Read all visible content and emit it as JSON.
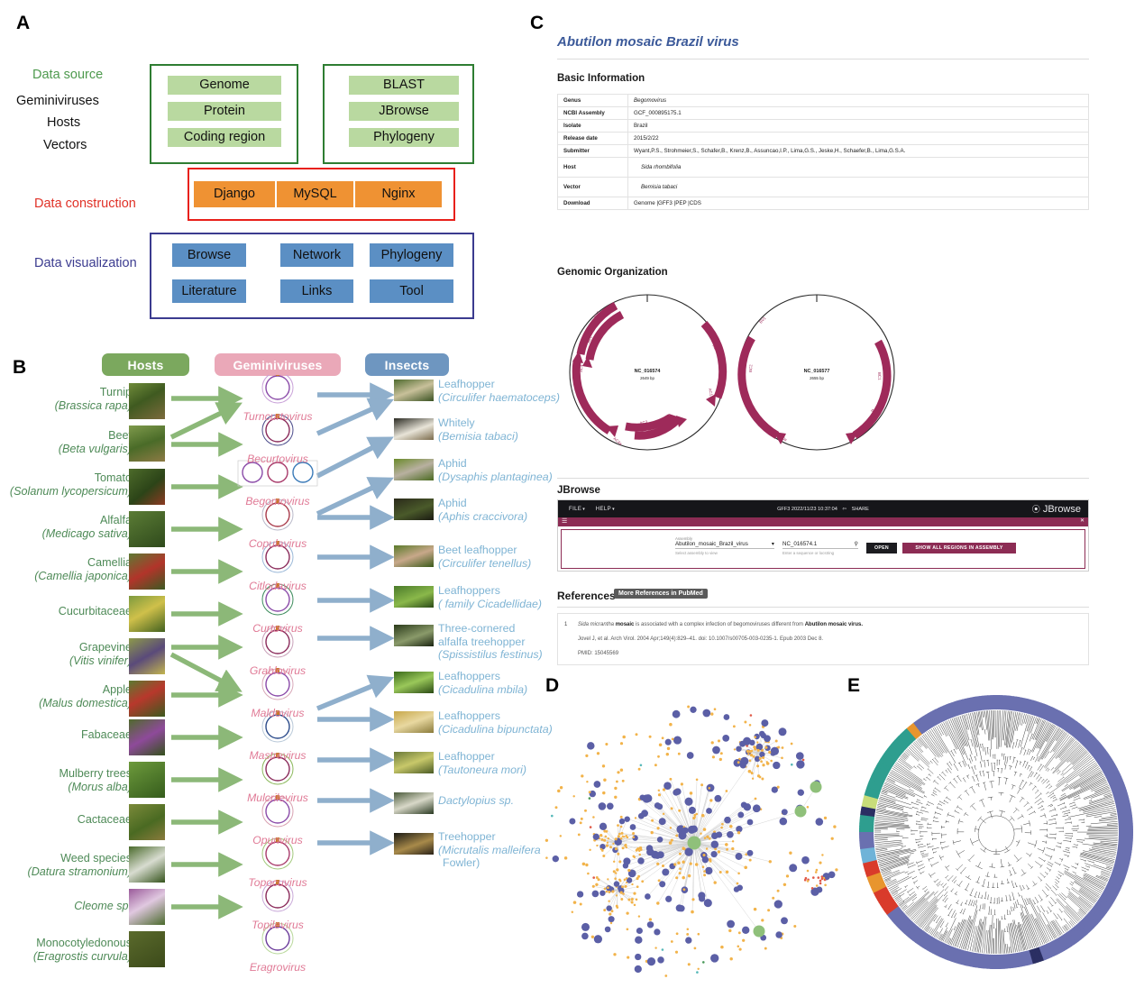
{
  "panels": {
    "a": "A",
    "b": "B",
    "c": "C",
    "d": "D",
    "e": "E"
  },
  "panel_a": {
    "row_labels": [
      {
        "text": "Data source",
        "color": "#4e9a4e"
      },
      {
        "text": "Geminiviruses",
        "color": "#111111"
      },
      {
        "text": "Hosts",
        "color": "#111111"
      },
      {
        "text": "Vectors",
        "color": "#111111"
      },
      {
        "text": "Data construction",
        "color": "#e03127"
      },
      {
        "text": "Data visualization",
        "color": "#3b3b8f"
      }
    ],
    "source_box_left": [
      "Genome",
      "Protein",
      "Coding region"
    ],
    "source_box_right": [
      "BLAST",
      "JBrowse",
      "Phylogeny"
    ],
    "construction": [
      "Django",
      "MySQL",
      "Nginx"
    ],
    "visualization_row1": [
      "Browse",
      "Network",
      "Phylogeny"
    ],
    "visualization_row2": [
      "Literature",
      "Links",
      "Tool"
    ],
    "colors": {
      "green_border": "#2e7d32",
      "green_chip": "#b9d9a0",
      "red_border": "#e8201a",
      "orange_chip": "#ef9233",
      "blue_border": "#3b3b8f",
      "blue_chip": "#5b8fc4"
    }
  },
  "panel_b": {
    "headers": [
      {
        "label": "Hosts",
        "color": "#7ba košice"
      },
      {
        "label": "Geminiviruses",
        "color": "#eaa8b8"
      },
      {
        "label": "Insects",
        "color": "#6e96c0"
      }
    ],
    "header_hosts": "Hosts",
    "header_viruses": "Geminiviruses",
    "header_insects": "Insects",
    "hosts": [
      {
        "common": "Turnip",
        "latin": "(Brassica rapa)"
      },
      {
        "common": "Beet",
        "latin": "(Beta vulgaris)"
      },
      {
        "common": "Tomato",
        "latin": "(Solanum lycopersicum)"
      },
      {
        "common": "Alfalfa",
        "latin": "(Medicago sativa)"
      },
      {
        "common": "Camellia",
        "latin": "(Camellia japonica)"
      },
      {
        "common": "Cucurbitaceae",
        "latin": ""
      },
      {
        "common": "Grapevine",
        "latin": "(Vitis vinifer)"
      },
      {
        "common": "Apple",
        "latin": "(Malus domestica)"
      },
      {
        "common": "Fabaceae",
        "latin": ""
      },
      {
        "common": "Mulberry trees",
        "latin": "(Morus alba)"
      },
      {
        "common": "Cactaceae",
        "latin": ""
      },
      {
        "common": "Weed species",
        "latin": "(Datura stramonium)"
      },
      {
        "common": "Cleome sp.",
        "latin": ""
      },
      {
        "common": "Monocotyledonous",
        "latin": "(Eragrostis curvula)"
      }
    ],
    "viruses": [
      "Turncurtovirus",
      "Becurtovirus",
      "Begomovirus",
      "Copulavirus",
      "Citlodavirus",
      "Curtovirus",
      "Grablovirus",
      "Maldovirus",
      "Mastrevirus",
      "Mulcrilevirus",
      "Opunvirus",
      "Topocuvirus",
      "Topilevirus",
      "Eragrovirus"
    ],
    "insects": [
      {
        "common": "Leafhopper",
        "latin": "(Circulifer haematoceps)"
      },
      {
        "common": "Whitely",
        "latin": "(Bemisia tabaci)"
      },
      {
        "common": "Aphid",
        "latin": "(Dysaphis plantaginea)"
      },
      {
        "common": "Aphid",
        "latin": "(Aphis craccivora)"
      },
      {
        "common": "Beet leafhopper",
        "latin": "(Circulifer tenellus)"
      },
      {
        "common": "Leafhoppers",
        "latin": "( family Cicadellidae)"
      },
      {
        "common": "Three-cornered alfalfa treehopper",
        "latin": "(Spissistilus festinus)"
      },
      {
        "common": "Leafhoppers",
        "latin": "(Cicadulina mbila)"
      },
      {
        "common": "Leafhoppers",
        "latin": "(Cicadulina bipunctata)"
      },
      {
        "common": "Leafhopper",
        "latin": "(Tautoneura mori)"
      },
      {
        "common": "Dactylopius sp.",
        "latin": ""
      },
      {
        "common": "Treehopper",
        "latin": "(Micrutalis malleifera Fowler)"
      }
    ]
  },
  "panel_c": {
    "title": "Abutilon mosaic Brazil virus",
    "section_basic": "Basic Information",
    "section_genomic": "Genomic Organization",
    "section_jbrowse": "JBrowse",
    "section_references": "References",
    "table": [
      {
        "key": "Genus",
        "value": "Begomovirus",
        "style": "italic"
      },
      {
        "key": "NCBI Assembly",
        "value": "GCF_000895175.1",
        "style": "link"
      },
      {
        "key": "Isolate",
        "value": "Brazil",
        "style": "plain"
      },
      {
        "key": "Release date",
        "value": "2015/2/22",
        "style": "plain"
      },
      {
        "key": "Submitter",
        "value": "Wyant,P.S., Strohmeier,S., Schafer,B., Krenz,B., Assuncao,I.P., Lima,G.S., Jeske,H., Schaefer,B., Lima,G.S.A.",
        "style": "plain"
      },
      {
        "key": "Host",
        "value": "Sida rhombifolia",
        "style": "italic-link"
      },
      {
        "key": "Vector",
        "value": "Bemisia tabaci",
        "style": "italic-link"
      },
      {
        "key": "Download",
        "value": "Genome |GFF3 |PEP |CDS",
        "style": "link"
      }
    ],
    "genome_circles": [
      {
        "accession": "NC_016574",
        "length": "2649  bp",
        "genes": [
          "AV2",
          "AV1",
          "AC3",
          "AC2",
          "AC1",
          "AC4",
          "AC5"
        ]
      },
      {
        "accession": "NC_016577",
        "length": "2655  bp",
        "genes": [
          "BV1",
          "BC1"
        ]
      }
    ],
    "jbrowse": {
      "menu_file": "FILE",
      "menu_help": "HELP",
      "center_status": "GFF3 2022/11/23 10:37:04",
      "share": "SHARE",
      "logo": "JBrowse",
      "assembly_label": "Assembly",
      "assembly_value": "Abutilon_mosaic_Brazil_virus",
      "assembly_help": "Select assembly to view",
      "locus_value": "NC_016574.1",
      "locus_help": "Enter a sequence or locstring",
      "open_button": "OPEN",
      "show_all_button": "SHOW ALL REGIONS IN ASSEMBLY"
    },
    "references": {
      "more_button": "More References in PubMed",
      "number": "1",
      "line1_a": "Sida micrantha ",
      "line1_b": "mosaic",
      "line1_c": " is associated with a complex infection of begomoviruses different from ",
      "line1_d": "Abutilon mosaic virus.",
      "line2": "Jovel J, et al.  Arch Virol. 2004 Apr;149(4):829–41. doi: 10.1007/s00705-003-0235-1. Epub 2003 Dec 8.",
      "line3": "PMID: 15045569"
    }
  },
  "panel_d": {
    "description": "Virus-host-vector association network graph",
    "node_colors": {
      "hub": "#8fc07a",
      "virus": "#5b5fa6",
      "small": "#f2b34a",
      "red": "#e05a48",
      "green": "#4a9a5a",
      "teal": "#56b8b8"
    }
  },
  "panel_e": {
    "description": "Circular phylogenetic tree of geminivirus genomes",
    "ring_colors": {
      "main": "#6a70b0",
      "teal": "#2e9e8f",
      "orange": "#e8952e",
      "red": "#d93b2b",
      "lightblue": "#6fb3d8",
      "darknavy": "#2b2f63",
      "lightgreen": "#c8dd7a"
    }
  }
}
